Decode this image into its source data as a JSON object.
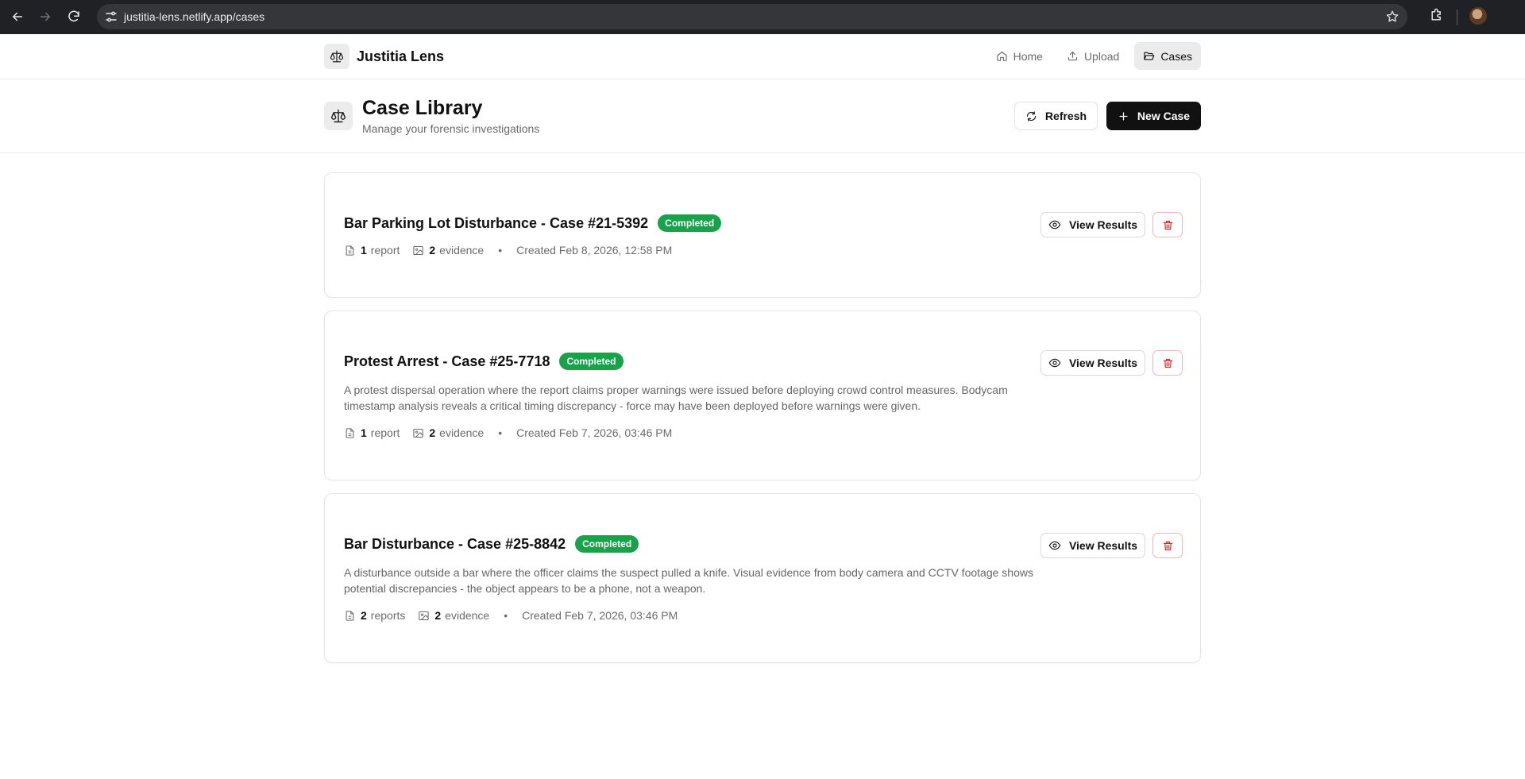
{
  "browser": {
    "url": "justitia-lens.netlify.app/cases",
    "back_icon": "arrow-left-icon",
    "forward_icon": "arrow-right-icon",
    "reload_icon": "reload-icon",
    "bookmark_icon": "star-icon",
    "extensions_icon": "puzzle-icon"
  },
  "app": {
    "brand": "Justitia Lens",
    "logo_icon": "scale-icon",
    "nav": [
      {
        "label": "Home",
        "icon": "home-icon",
        "active": false
      },
      {
        "label": "Upload",
        "icon": "upload-icon",
        "active": false
      },
      {
        "label": "Cases",
        "icon": "folder-open-icon",
        "active": true
      }
    ]
  },
  "page": {
    "title": "Case Library",
    "subtitle": "Manage your forensic investigations",
    "refresh_label": "Refresh",
    "new_case_label": "New Case"
  },
  "colors": {
    "badge_green": "#16a34a",
    "primary_black": "#111111",
    "delete_red": "#dc2626"
  },
  "cases": [
    {
      "title": "Bar Parking Lot Disturbance - Case #21-5392",
      "status": "Completed",
      "description": "",
      "report_count": "1",
      "report_label": "report",
      "evidence_count": "2",
      "evidence_label": "evidence",
      "created": "Created Feb 8, 2026, 12:58 PM",
      "view_label": "View Results"
    },
    {
      "title": "Protest Arrest - Case #25-7718",
      "status": "Completed",
      "description": "A protest dispersal operation where the report claims proper warnings were issued before deploying crowd control measures. Bodycam timestamp analysis reveals a critical timing discrepancy - force may have been deployed before warnings were given.",
      "report_count": "1",
      "report_label": "report",
      "evidence_count": "2",
      "evidence_label": "evidence",
      "created": "Created Feb 7, 2026, 03:46 PM",
      "view_label": "View Results"
    },
    {
      "title": "Bar Disturbance - Case #25-8842",
      "status": "Completed",
      "description": "A disturbance outside a bar where the officer claims the suspect pulled a knife. Visual evidence from body camera and CCTV footage shows potential discrepancies - the object appears to be a phone, not a weapon.",
      "report_count": "2",
      "report_label": "reports",
      "evidence_count": "2",
      "evidence_label": "evidence",
      "created": "Created Feb 7, 2026, 03:46 PM",
      "view_label": "View Results"
    }
  ]
}
